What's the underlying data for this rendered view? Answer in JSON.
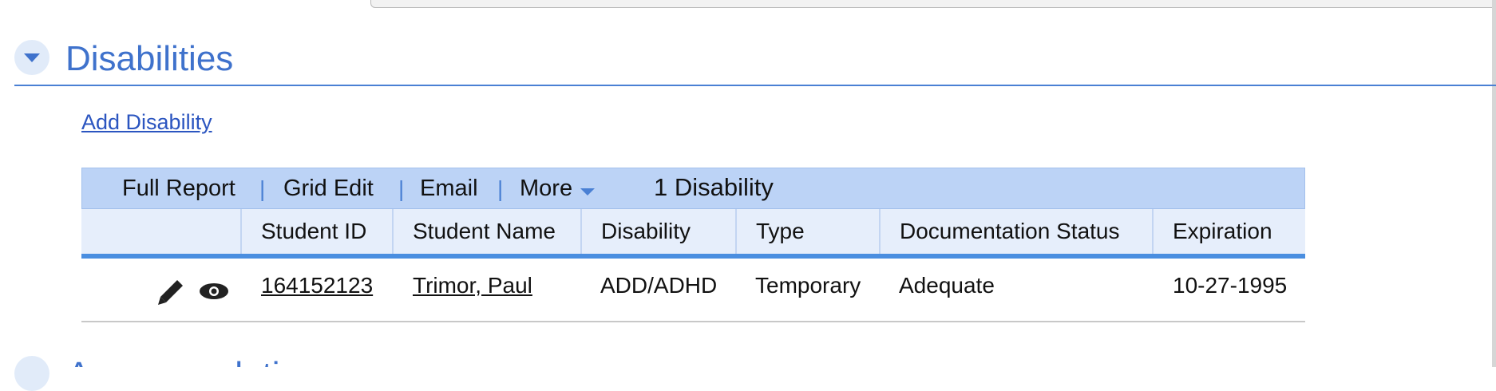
{
  "section": {
    "title": "Disabilities",
    "add_link": "Add Disability"
  },
  "toolbar": {
    "items": [
      "Full Report",
      "Grid Edit",
      "Email",
      "More"
    ],
    "count_label": "1 Disability"
  },
  "table": {
    "columns": [
      "Student ID",
      "Student Name",
      "Disability",
      "Type",
      "Documentation Status",
      "Expiration"
    ],
    "rows": [
      {
        "student_id": "164152123",
        "student_name": "Trimor, Paul",
        "disability": "ADD/ADHD",
        "type": "Temporary",
        "documentation_status": "Adequate",
        "expiration": "10-27-1995"
      }
    ]
  },
  "next_section": {
    "title": "Accommodations"
  },
  "icons": {
    "collapse": "chevron-down-icon",
    "edit": "pencil-icon",
    "view": "eye-icon",
    "more": "caret-down-icon"
  },
  "colors": {
    "accent": "#3f72cc",
    "toolbar_bg": "#bcd3f6",
    "header_bg": "#e6eefb",
    "header_border": "#4a8ee0",
    "link": "#2b55c0"
  }
}
